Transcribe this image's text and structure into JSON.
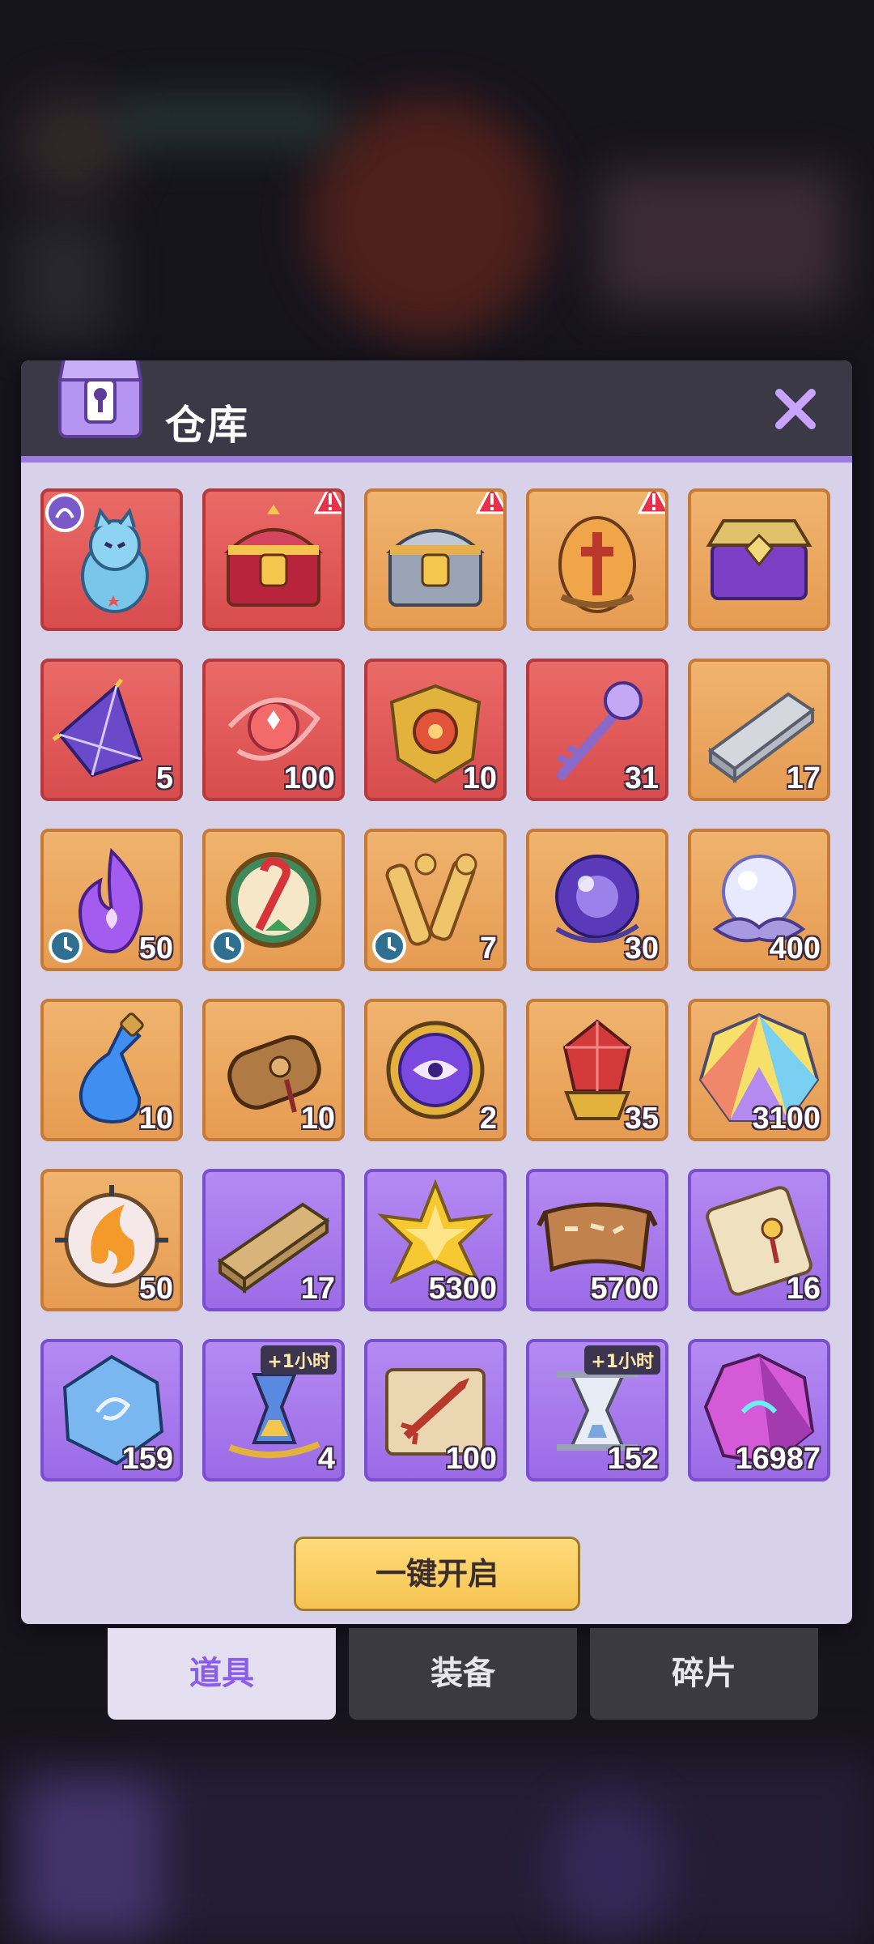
{
  "window": {
    "title": "仓库",
    "close_icon": "close-x-icon",
    "accent": "#9b7be0"
  },
  "items": [
    {
      "rarity": "red",
      "icon": "ghost-bear-icon",
      "qty": "",
      "tag": "portrait-tag"
    },
    {
      "rarity": "red",
      "icon": "gold-chest-icon",
      "qty": "",
      "alert": true
    },
    {
      "rarity": "orange",
      "icon": "silver-chest-icon",
      "qty": "",
      "alert": true
    },
    {
      "rarity": "orange",
      "icon": "dragon-egg-icon",
      "qty": "",
      "alert": true
    },
    {
      "rarity": "orange",
      "icon": "purple-chest-icon",
      "qty": ""
    },
    {
      "rarity": "red",
      "icon": "purple-crystal-icon",
      "qty": "5"
    },
    {
      "rarity": "red",
      "icon": "red-orb-swirl-icon",
      "qty": "100"
    },
    {
      "rarity": "red",
      "icon": "gold-emblem-icon",
      "qty": "10"
    },
    {
      "rarity": "red",
      "icon": "crystal-key-icon",
      "qty": "31"
    },
    {
      "rarity": "orange",
      "icon": "silver-ingot-icon",
      "qty": "17"
    },
    {
      "rarity": "orange",
      "icon": "purple-flame-icon",
      "qty": "50",
      "timer": true
    },
    {
      "rarity": "orange",
      "icon": "candy-cane-emblem-icon",
      "qty": "",
      "timer": true
    },
    {
      "rarity": "orange",
      "icon": "scroll-pair-icon",
      "qty": "7",
      "timer": true
    },
    {
      "rarity": "orange",
      "icon": "purple-orb-icon",
      "qty": "30"
    },
    {
      "rarity": "orange",
      "icon": "white-pearl-icon",
      "qty": "400"
    },
    {
      "rarity": "orange",
      "icon": "blue-potion-icon",
      "qty": "10"
    },
    {
      "rarity": "orange",
      "icon": "leather-scroll-icon",
      "qty": "10"
    },
    {
      "rarity": "orange",
      "icon": "purple-eye-coin-icon",
      "qty": "2"
    },
    {
      "rarity": "orange",
      "icon": "red-gem-icon",
      "qty": "35"
    },
    {
      "rarity": "orange",
      "icon": "rainbow-gem-icon",
      "qty": "3100"
    },
    {
      "rarity": "orange",
      "icon": "fire-orb-icon",
      "qty": "50"
    },
    {
      "rarity": "purple",
      "icon": "wood-plank-icon",
      "qty": "17"
    },
    {
      "rarity": "purple",
      "icon": "gold-star-icon",
      "qty": "5300"
    },
    {
      "rarity": "purple",
      "icon": "map-banner-icon",
      "qty": "5700"
    },
    {
      "rarity": "purple",
      "icon": "parchment-scroll-icon",
      "qty": "16"
    },
    {
      "rarity": "purple",
      "icon": "blue-crystal-icon",
      "qty": "159"
    },
    {
      "rarity": "purple",
      "icon": "hourglass-potion-icon",
      "qty": "4",
      "badge": "+1小时"
    },
    {
      "rarity": "purple",
      "icon": "sword-scroll-icon",
      "qty": "100"
    },
    {
      "rarity": "purple",
      "icon": "silver-hourglass-icon",
      "qty": "152",
      "badge": "+1小时"
    },
    {
      "rarity": "purple",
      "icon": "pink-gem-icon",
      "qty": "16987"
    },
    {
      "rarity": "purple",
      "icon": "partial-item-icon",
      "qty": ""
    },
    {
      "rarity": "blue",
      "icon": "partial-item-icon",
      "qty": ""
    },
    {
      "rarity": "blue",
      "icon": "partial-item-icon",
      "qty": ""
    },
    {
      "rarity": "blue",
      "icon": "partial-item-icon",
      "qty": ""
    },
    {
      "rarity": "green",
      "icon": "partial-item-icon",
      "qty": ""
    }
  ],
  "actions": {
    "open_all": "一键开启"
  },
  "tabs": [
    {
      "label": "道具",
      "active": true
    },
    {
      "label": "装备",
      "active": false
    },
    {
      "label": "碎片",
      "active": false
    }
  ]
}
